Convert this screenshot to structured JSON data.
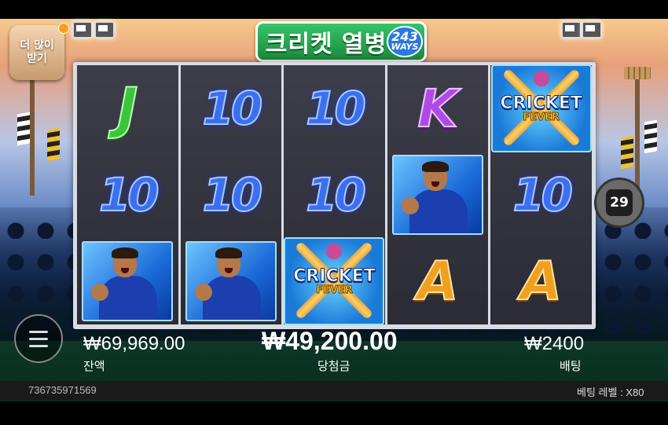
{
  "header": {
    "more_label_line1": "더 많이",
    "more_label_line2": "받기",
    "logo_text": "크리켓 열병",
    "ways_count": "243",
    "ways_label": "WAYS"
  },
  "reels": [
    [
      "J",
      "10",
      "player"
    ],
    [
      "10",
      "10",
      "player"
    ],
    [
      "10",
      "10",
      "wild"
    ],
    [
      "K",
      "player",
      "A"
    ],
    [
      "wild",
      "10",
      "A"
    ]
  ],
  "wild_symbol": {
    "line1": "CRICKET",
    "line2": "FEVER"
  },
  "side_counter": "29",
  "footer": {
    "balance_value": "₩69,969.00",
    "balance_label": "잔액",
    "win_value": "₩49,200.00",
    "win_label": "당첨금",
    "bet_value": "₩2400",
    "bet_label": "배팅",
    "round_id": "736735971569",
    "bet_level": "베팅 레벨 : X80"
  },
  "colors": {
    "logo_green": "#1a8a3c",
    "ten_blue": "#3c6ff0",
    "j_green": "#3cc43c",
    "k_purple": "#b04ae6",
    "a_orange": "#f0a020"
  }
}
